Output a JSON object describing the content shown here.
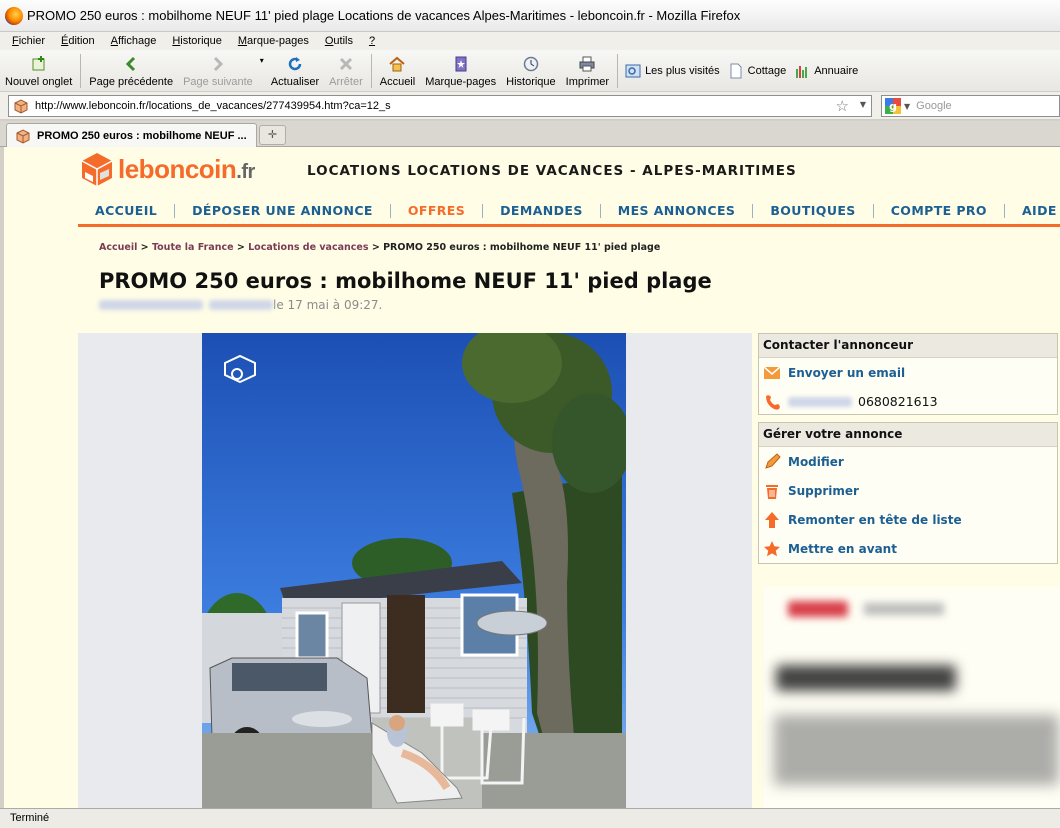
{
  "window": {
    "title": "PROMO 250 euros : mobilhome NEUF 11' pied plage Locations de vacances Alpes-Maritimes - leboncoin.fr - Mozilla Firefox"
  },
  "menu": [
    {
      "pre": "",
      "u": "F",
      "post": "ichier"
    },
    {
      "pre": "",
      "u": "É",
      "post": "dition"
    },
    {
      "pre": "",
      "u": "A",
      "post": "ffichage"
    },
    {
      "pre": "",
      "u": "H",
      "post": "istorique"
    },
    {
      "pre": "",
      "u": "M",
      "post": "arque-pages"
    },
    {
      "pre": "",
      "u": "O",
      "post": "utils"
    },
    {
      "pre": "",
      "u": "?",
      "post": ""
    }
  ],
  "toolbar": {
    "new_tab": "Nouvel onglet",
    "back": "Page précédente",
    "forward": "Page suivante",
    "reload": "Actualiser",
    "stop": "Arrêter",
    "home": "Accueil",
    "bookmarks": "Marque-pages",
    "history": "Historique",
    "print": "Imprimer",
    "most_visited": "Les plus visités",
    "cottage": "Cottage",
    "annuaire": "Annuaire"
  },
  "navbar": {
    "url": "http://www.leboncoin.fr/locations_de_vacances/277439954.htm?ca=12_s",
    "search_placeholder": "Google"
  },
  "tabs": [
    {
      "label": "PROMO 250 euros : mobilhome NEUF ..."
    }
  ],
  "site": {
    "logo_main": "leboncoin",
    "logo_tld": ".fr",
    "headline": "LOCATIONS LOCATIONS DE VACANCES - ALPES-MARITIMES",
    "nav": [
      "ACCUEIL",
      "DÉPOSER UNE ANNONCE",
      "OFFRES",
      "DEMANDES",
      "MES ANNONCES",
      "BOUTIQUES",
      "COMPTE PRO",
      "AIDE"
    ],
    "nav_active_index": 2,
    "breadcrumb": {
      "c1": "Accueil",
      "c2": "Toute la France",
      "c3": "Locations de vacances",
      "sep": ">",
      "current": "PROMO 250 euros : mobilhome NEUF 11' pied plage"
    },
    "ad_title": "PROMO 250 euros : mobilhome NEUF 11' pied plage",
    "posted_suffix": " le 17 mai à 09:27."
  },
  "contact": {
    "header": "Contacter l'annonceur",
    "email_link": "Envoyer un email",
    "phone": "0680821613"
  },
  "manage": {
    "header": "Gérer votre annonce",
    "modify": "Modifier",
    "delete": "Supprimer",
    "bump": "Remonter en tête de liste",
    "feature": "Mettre en avant"
  },
  "status": {
    "text": "Terminé"
  },
  "colors": {
    "brand_orange": "#f56b2a",
    "link_blue": "#1b5f93",
    "page_bg": "#fffde6"
  }
}
